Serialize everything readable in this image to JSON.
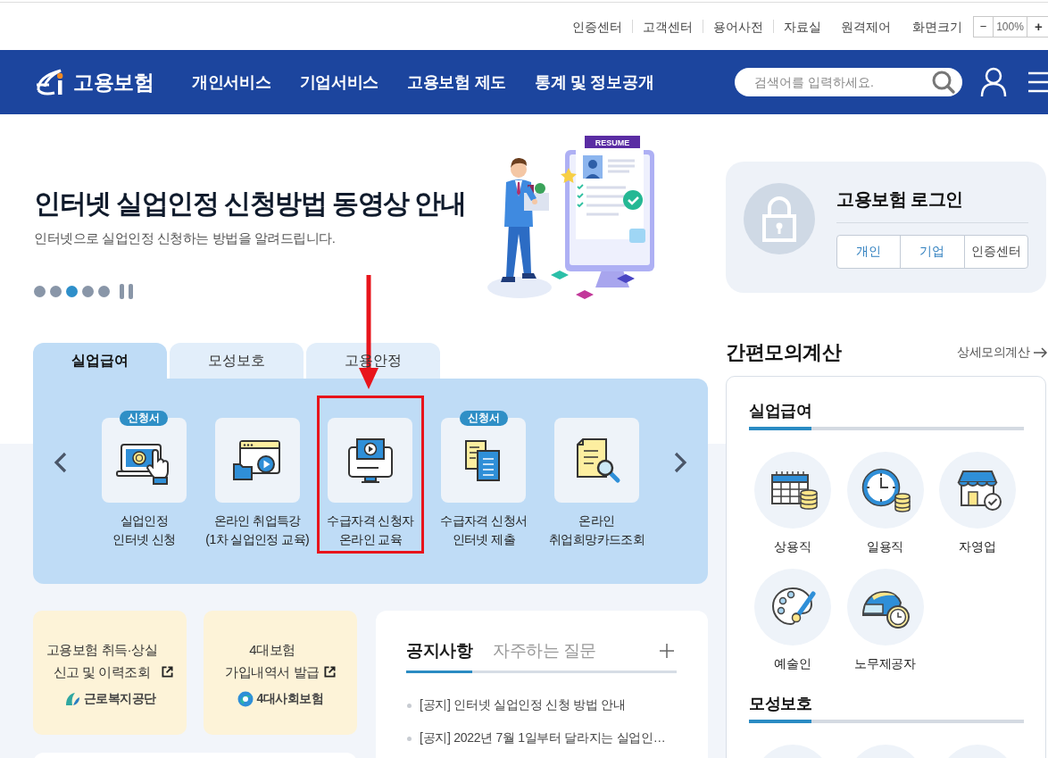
{
  "top_bar": {
    "links": [
      "인증센터",
      "고객센터",
      "용어사전",
      "자료실"
    ],
    "remote": "원격제어",
    "screen_size": {
      "label": "화면크기",
      "minus": "−",
      "value": "100%",
      "plus": "+"
    }
  },
  "header": {
    "logo": "고용보험",
    "nav": [
      "개인서비스",
      "기업서비스",
      "고용보험 제도",
      "통계 및 정보공개"
    ],
    "search": {
      "placeholder": "검색어를 입력하세요."
    }
  },
  "hero": {
    "title": "인터넷 실업인정 신청방법 동영상 안내",
    "subtitle": "인터넷으로 실업인정 신청하는 방법을 알려드립니다.",
    "illustration_label": "RESUME",
    "slides": [
      {
        "selected": false
      },
      {
        "selected": false
      },
      {
        "selected": true
      },
      {
        "selected": false
      },
      {
        "selected": false
      }
    ]
  },
  "services": {
    "tabs": [
      {
        "label": "실업급여",
        "selected": true
      },
      {
        "label": "모성보호",
        "selected": false
      },
      {
        "label": "고용안정",
        "selected": false
      }
    ],
    "items": [
      {
        "label": "실업인정\n인터넷 신청",
        "badge": "신청서",
        "highlighted": false
      },
      {
        "label": "온라인 취업특강\n(1차 실업인정 교육)",
        "highlighted": false
      },
      {
        "label": "수급자격 신청자\n온라인 교육",
        "highlighted": true
      },
      {
        "label": "수급자격 신청서\n인터넷 제출",
        "badge": "신청서",
        "highlighted": false
      },
      {
        "label": "온라인\n취업희망카드조회",
        "highlighted": false
      }
    ]
  },
  "shortcuts": [
    {
      "label": "고용보험 취득·상실\n신고 및 이력조회",
      "org": "근로복지공단"
    },
    {
      "label": "4대보험\n가입내역서 발급",
      "org": "4대사회보험"
    }
  ],
  "notices": {
    "tabs": [
      {
        "label": "공지사항",
        "selected": true
      },
      {
        "label": "자주하는 질문",
        "selected": false
      }
    ],
    "items": [
      "[공지] 인터넷 실업인정 신청 방법 안내",
      "[공지] 2022년 7월 1일부터 달라지는 실업인…"
    ]
  },
  "login": {
    "title": "고용보험 로그인",
    "buttons": [
      {
        "label": "개인",
        "kind": "account"
      },
      {
        "label": "기업",
        "kind": "account"
      },
      {
        "label": "인증센터",
        "kind": "center"
      }
    ]
  },
  "calculator": {
    "title": "간편모의계산",
    "detail_link": "상세모의계산",
    "sections": [
      {
        "title": "실업급여",
        "items": [
          {
            "kind": "option",
            "label": "상용직"
          },
          {
            "kind": "option",
            "label": "일용직"
          },
          {
            "kind": "option",
            "label": "자영업"
          },
          {
            "kind": "option",
            "label": "예술인"
          },
          {
            "kind": "option",
            "label": "노무제공자"
          }
        ]
      },
      {
        "title": "모성보호",
        "items": [
          {
            "kind": "cut"
          },
          {
            "kind": "cut"
          },
          {
            "kind": "cut"
          }
        ]
      }
    ]
  }
}
